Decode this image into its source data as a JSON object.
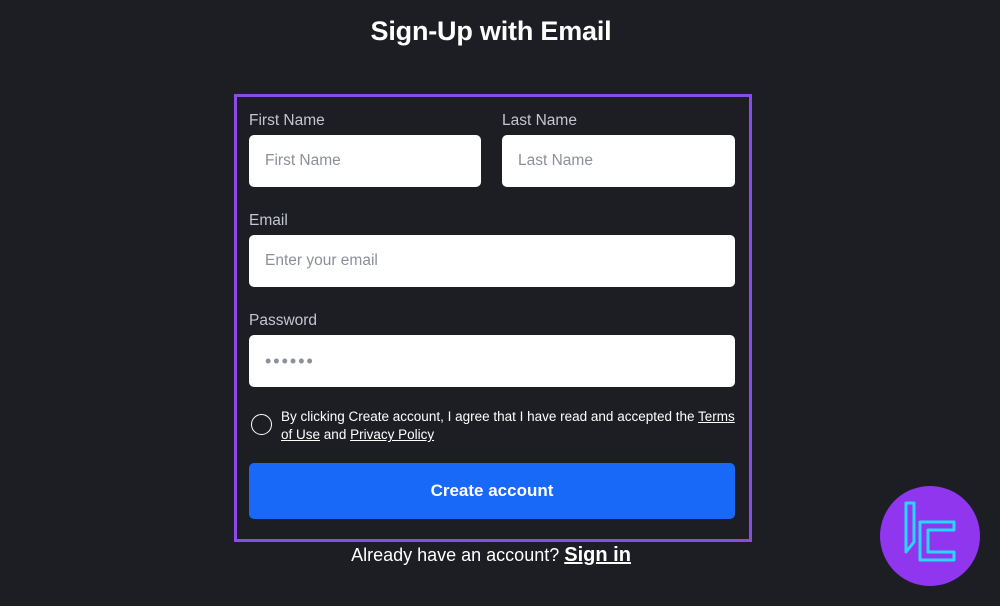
{
  "page": {
    "title": "Sign-Up with Email"
  },
  "form": {
    "first_name": {
      "label": "First Name",
      "placeholder": "First Name"
    },
    "last_name": {
      "label": "Last Name",
      "placeholder": "Last Name"
    },
    "email": {
      "label": "Email",
      "placeholder": "Enter your email"
    },
    "password": {
      "label": "Password",
      "placeholder": "••••••"
    },
    "agreement": {
      "text_prefix": "By clicking Create account, I agree that I have read and accepted the",
      "terms_link": "Terms of Use",
      "and_text": "and",
      "privacy_link": "Privacy Policy",
      "checked": false
    },
    "submit_label": "Create account"
  },
  "signin": {
    "prompt": "Already have an account?",
    "link": "Sign in"
  },
  "colors": {
    "background": "#1d1d24",
    "frame_border": "#8a4be6",
    "primary_button": "#1869f7",
    "logo_badge": "#9036ee",
    "logo_glyph": "#29d6ff"
  },
  "icons": {
    "brand_logo": "brand-logo-icon",
    "agree_radio": "radio-circle-icon"
  }
}
